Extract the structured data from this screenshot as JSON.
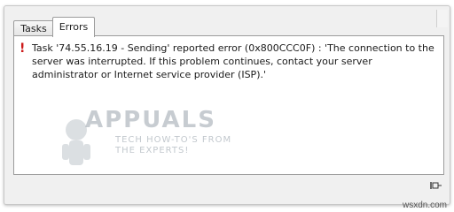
{
  "tabs": [
    {
      "label": "Tasks",
      "active": false
    },
    {
      "label": "Errors",
      "active": true
    }
  ],
  "error": {
    "icon": "error-exclamation-icon",
    "color": "#cc1a1a",
    "message": "Task '74.55.16.19 - Sending' reported error (0x800CCC0F) : 'The connection to the server was interrupted.  If this problem continues, contact your server administrator or Internet service provider (ISP).'"
  },
  "watermark": {
    "brand": "APPUALS",
    "tagline_line1": "TECH HOW-TO'S FROM",
    "tagline_line2": "THE EXPERTS!"
  },
  "footer": {
    "pin_icon": "pin-icon",
    "credit": "wsxdn.com"
  }
}
